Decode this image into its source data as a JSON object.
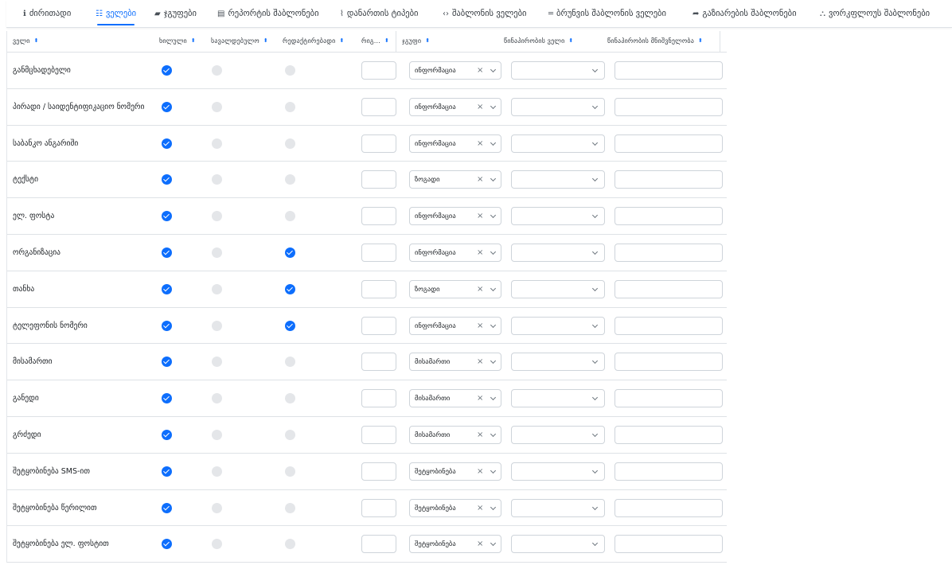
{
  "tabs": [
    {
      "label": "ძირითადი",
      "icon": "info-circle-icon",
      "glyph": "ℹ",
      "active": false
    },
    {
      "label": "ველები",
      "icon": "list-icon",
      "glyph": "☷",
      "active": true
    },
    {
      "label": "ჯგუფები",
      "icon": "folder-icon",
      "glyph": "▰",
      "active": false
    },
    {
      "label": "რეპორტის შაბლონები",
      "icon": "file-icon",
      "glyph": "▤",
      "active": false
    },
    {
      "label": "დანართის ტიპები",
      "icon": "paperclip-icon",
      "glyph": "⌇",
      "active": false
    },
    {
      "label": "შაბლონის ველები",
      "icon": "code-icon",
      "glyph": "‹›",
      "active": false
    },
    {
      "label": "ბრუნვის შაბლონის ველები",
      "icon": "equals-icon",
      "glyph": "═",
      "active": false
    },
    {
      "label": "გაზიარების შაბლონები",
      "icon": "share-icon",
      "glyph": "➦",
      "active": false
    },
    {
      "label": "ვორკფლოუს შაბლონები",
      "icon": "sitemap-icon",
      "glyph": "⛬",
      "active": false
    }
  ],
  "columns": {
    "field": "ველი",
    "visible": "ხილული",
    "required": "სავალდებულო",
    "editable": "რედაქტირებადი",
    "order": "რიგ...",
    "group": "ჯგუფი",
    "condition_field": "წინაპირობის ველი",
    "condition_value": "წინაპირობის მნიშვნელობა"
  },
  "rows": [
    {
      "field": "განმცხადებელი",
      "visible": true,
      "required": false,
      "editable": false,
      "group": "ინფორმაცია"
    },
    {
      "field": "პირადი / საიდენტიფიკაციო ნომერი",
      "visible": true,
      "required": false,
      "editable": false,
      "group": "ინფორმაცია"
    },
    {
      "field": "საბანკო ანგარიში",
      "visible": true,
      "required": false,
      "editable": false,
      "group": "ინფორმაცია"
    },
    {
      "field": "ტექსტი",
      "visible": true,
      "required": false,
      "editable": false,
      "group": "ზოგადი"
    },
    {
      "field": "ელ. ფოსტა",
      "visible": true,
      "required": false,
      "editable": false,
      "group": "ინფორმაცია"
    },
    {
      "field": "ორგანიზაცია",
      "visible": true,
      "required": false,
      "editable": true,
      "group": "ინფორმაცია"
    },
    {
      "field": "თანხა",
      "visible": true,
      "required": false,
      "editable": true,
      "group": "ზოგადი"
    },
    {
      "field": "ტელეფონის ნომერი",
      "visible": true,
      "required": false,
      "editable": true,
      "group": "ინფორმაცია"
    },
    {
      "field": "მისამართი",
      "visible": true,
      "required": false,
      "editable": false,
      "group": "მისამართი"
    },
    {
      "field": "განედი",
      "visible": true,
      "required": false,
      "editable": false,
      "group": "მისამართი"
    },
    {
      "field": "გრძედი",
      "visible": true,
      "required": false,
      "editable": false,
      "group": "მისამართი"
    },
    {
      "field": "შეტყობინება SMS-ით",
      "visible": true,
      "required": false,
      "editable": false,
      "group": "შეტყობინება"
    },
    {
      "field": "შეტყობინება წერილით",
      "visible": true,
      "required": false,
      "editable": false,
      "group": "შეტყობინება"
    },
    {
      "field": "შეტყობინება ელ. ფოსტით",
      "visible": true,
      "required": false,
      "editable": false,
      "group": "შეტყობინება"
    }
  ],
  "colors": {
    "accent": "#0d6efd",
    "border": "#dee2e6",
    "disabled": "#e4e6e9"
  }
}
